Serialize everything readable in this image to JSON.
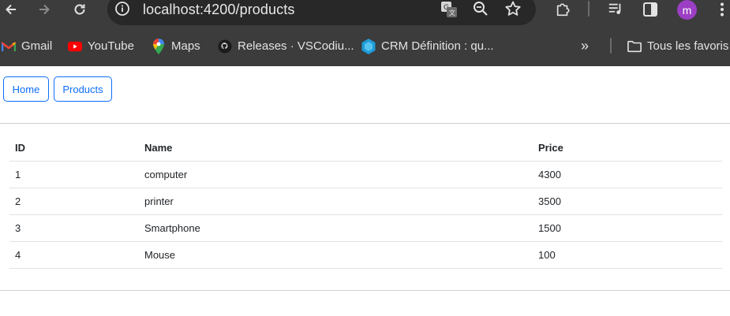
{
  "browser": {
    "url": "localhost:4200/products",
    "profile_initial": "m",
    "profile_color": "#9c3fc4",
    "bookmarks": [
      {
        "label": "Gmail",
        "icon": "gmail-icon"
      },
      {
        "label": "YouTube",
        "icon": "youtube-icon"
      },
      {
        "label": "Maps",
        "icon": "maps-icon"
      },
      {
        "label": "Releases · VSCodiu...",
        "icon": "github-icon"
      },
      {
        "label": "CRM Définition : qu...",
        "icon": "crm-icon"
      }
    ],
    "overflow_glyph": "»",
    "all_bookmarks_label": "Tous les favoris"
  },
  "nav": {
    "home_label": "Home",
    "products_label": "Products"
  },
  "table": {
    "headers": [
      "ID",
      "Name",
      "Price"
    ],
    "rows": [
      [
        "1",
        "computer",
        "4300"
      ],
      [
        "2",
        "printer",
        "3500"
      ],
      [
        "3",
        "Smartphone",
        "1500"
      ],
      [
        "4",
        "Mouse",
        "100"
      ]
    ]
  },
  "colors": {
    "chrome_bg": "#3c3c3c",
    "omnibox_bg": "#282828",
    "link_blue": "#0d6efd"
  }
}
